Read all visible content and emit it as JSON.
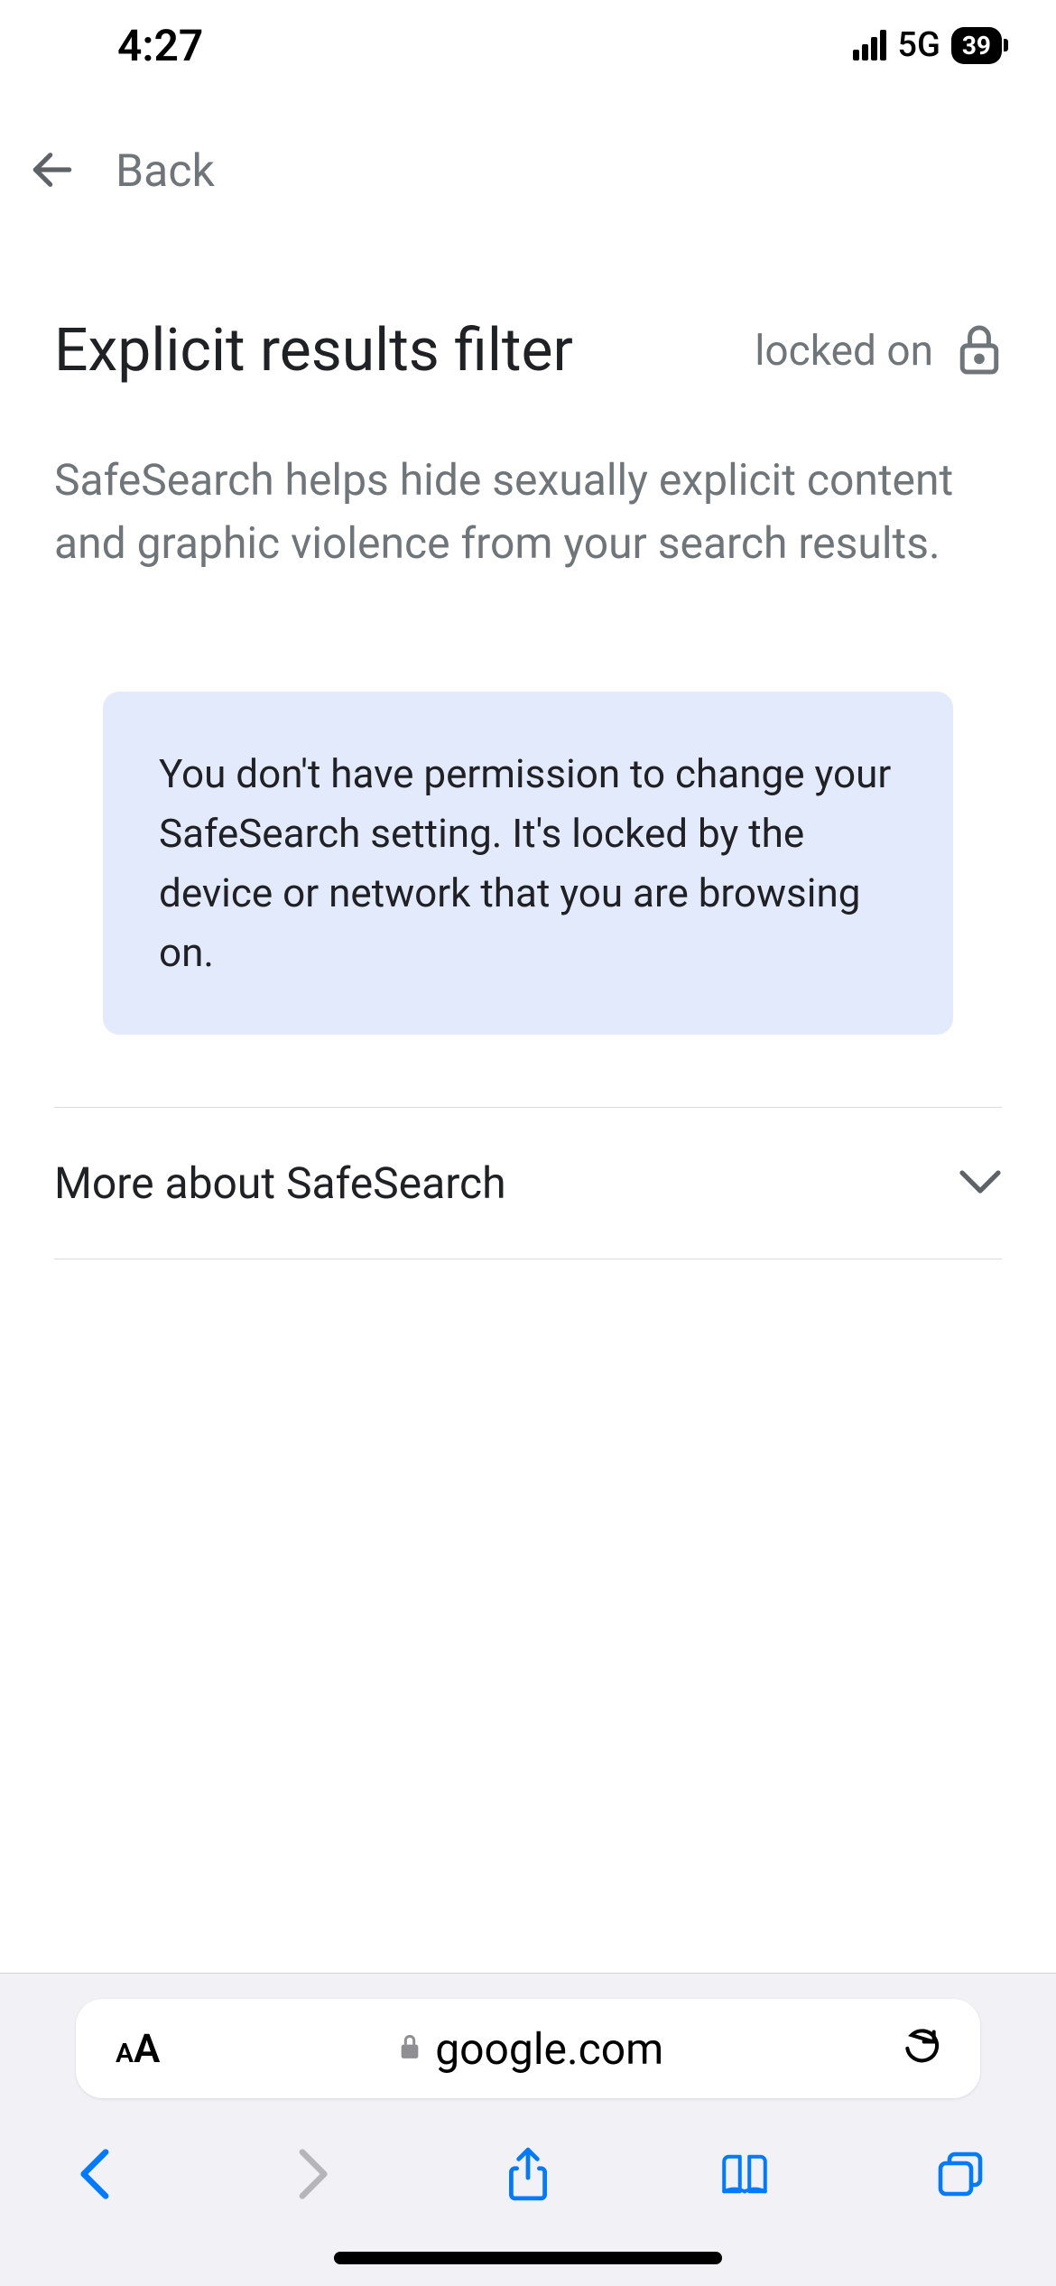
{
  "statusBar": {
    "time": "4:27",
    "networkType": "5G",
    "batteryLevel": "39"
  },
  "nav": {
    "backLabel": "Back"
  },
  "header": {
    "title": "Explicit results filter",
    "lockStatus": "locked on"
  },
  "description": "SafeSearch helps hide sexually explicit content and graphic violence from your search results.",
  "infoBox": {
    "text": "You don't have permission to change your SafeSearch setting. It's locked by the device or network that you are browsing on."
  },
  "expander": {
    "label": "More about SafeSearch"
  },
  "browser": {
    "url": "google.com"
  },
  "colors": {
    "safariBlue": "#007aff",
    "grayText": "#70757a",
    "infoBoxBg": "#e2eafc"
  }
}
